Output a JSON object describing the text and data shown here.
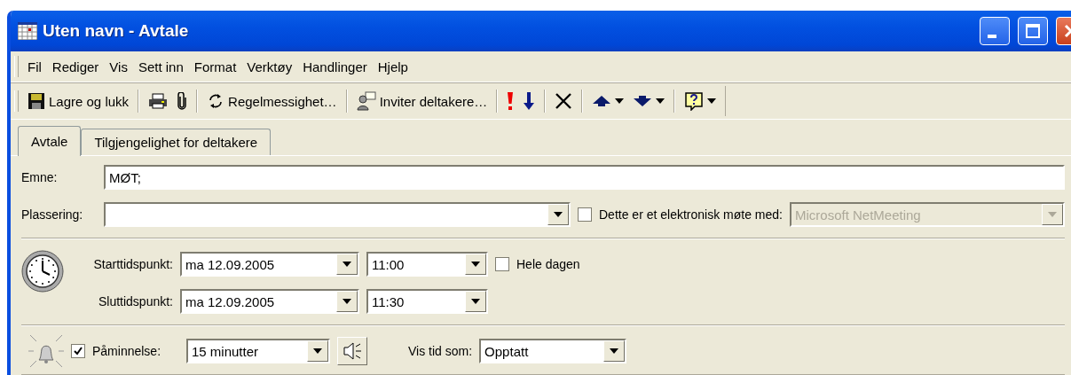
{
  "window": {
    "title": "Uten navn - Avtale"
  },
  "menu": [
    "Fil",
    "Rediger",
    "Vis",
    "Sett inn",
    "Format",
    "Verktøy",
    "Handlinger",
    "Hjelp"
  ],
  "toolbar": {
    "save_label": "Lagre og lukk",
    "recurrence_label": "Regelmessighet…",
    "invite_label": "Inviter deltakere…"
  },
  "tabs": [
    {
      "label": "Avtale",
      "selected": true
    },
    {
      "label": "Tilgjengelighet for deltakere",
      "selected": false
    }
  ],
  "subject": {
    "label": "Emne:",
    "value": "MØT;"
  },
  "location": {
    "label": "Plassering:"
  },
  "online_meeting": {
    "label": "Dette er et elektronisk møte med:",
    "checked": false,
    "provider": "Microsoft NetMeeting",
    "disabled": true
  },
  "start": {
    "label": "Starttidspunkt:",
    "date": "ma 12.09.2005",
    "time": "11:00"
  },
  "all_day": {
    "label": "Hele dagen",
    "checked": false
  },
  "end": {
    "label": "Sluttidspunkt:",
    "date": "ma 12.09.2005",
    "time": "11:30"
  },
  "reminder": {
    "label": "Påminnelse:",
    "checked": true,
    "value": "15 minutter"
  },
  "show_as": {
    "label": "Vis tid som:",
    "value": "Opptatt"
  }
}
